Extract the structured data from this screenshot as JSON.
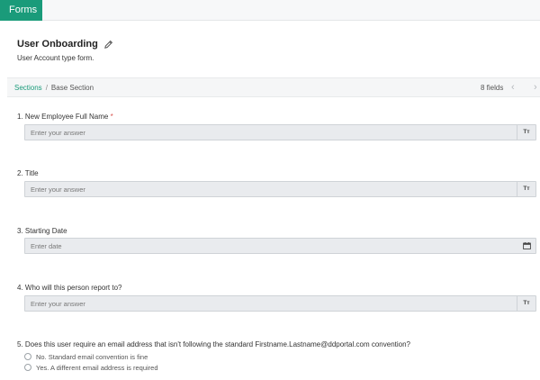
{
  "app": {
    "tab_label": "Forms"
  },
  "form": {
    "title": "User Onboarding",
    "subtitle": "User Account type form."
  },
  "section": {
    "crumb_root": "Sections",
    "crumb_separator": "/",
    "crumb_current": "Base Section",
    "field_count": "8 fields"
  },
  "questions": [
    {
      "label": "1. New Employee Full Name",
      "required_mark": "*",
      "placeholder": "Enter your answer",
      "trailing_icon": "Tт"
    },
    {
      "label": "2. Title",
      "placeholder": "Enter your answer",
      "trailing_icon": "Tт"
    },
    {
      "label": "3. Starting Date",
      "placeholder": "Enter date",
      "trailing_icon": "calendar-icon"
    },
    {
      "label": "4. Who will this person report to?",
      "placeholder": "Enter your answer",
      "trailing_icon": "Tт"
    },
    {
      "label": "5. Does this user require an email address that isn't following the standard Firstname.Lastname@ddportal.com convention?",
      "options": [
        "No. Standard email convention is fine",
        "Yes. A different email address is required"
      ]
    }
  ],
  "colors": {
    "accent": "#1a9b7a",
    "required": "#d9534f",
    "field_bg": "#e9ebee"
  }
}
